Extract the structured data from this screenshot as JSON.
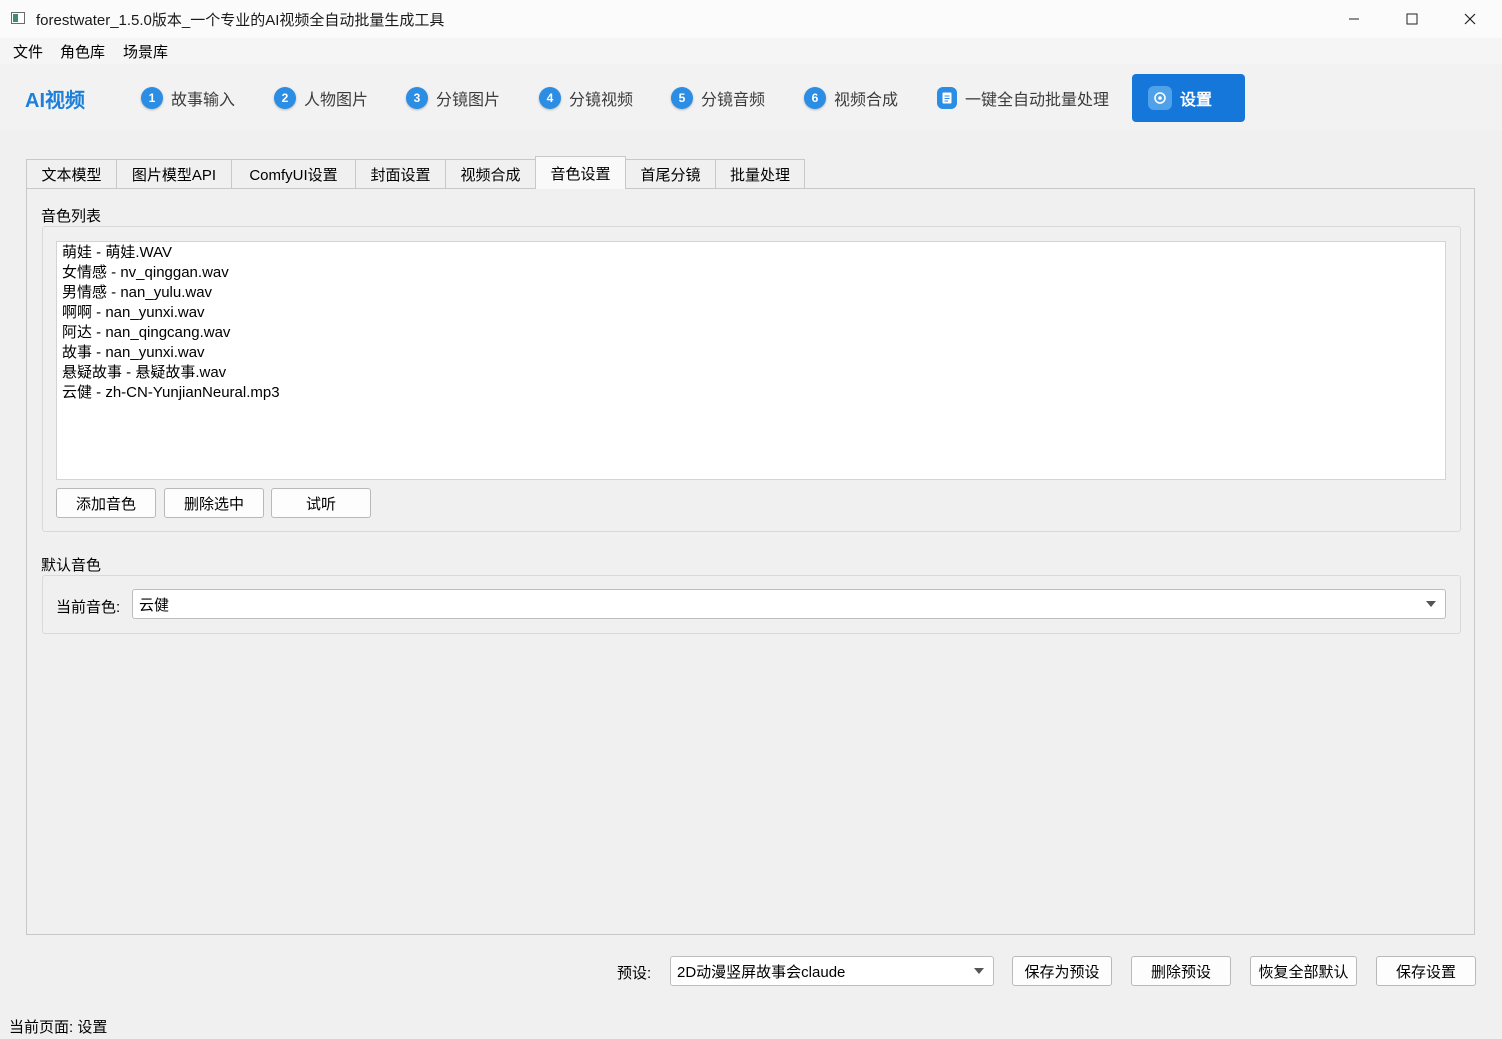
{
  "window": {
    "title": "forestwater_1.5.0版本_一个专业的AI视频全自动批量生成工具"
  },
  "menubar": {
    "items": [
      "文件",
      "角色库",
      "场景库"
    ]
  },
  "nav": {
    "brand": "AI视频",
    "steps": [
      {
        "num": "1",
        "label": "故事输入"
      },
      {
        "num": "2",
        "label": "人物图片"
      },
      {
        "num": "3",
        "label": "分镜图片"
      },
      {
        "num": "4",
        "label": "分镜视频"
      },
      {
        "num": "5",
        "label": "分镜音频"
      },
      {
        "num": "6",
        "label": "视频合成"
      }
    ],
    "batch_label": "一键全自动批量处理",
    "settings_label": "设置",
    "accent_color": "#1677db"
  },
  "tabs": [
    "文本模型",
    "图片模型API",
    "ComfyUI设置",
    "封面设置",
    "视频合成",
    "音色设置",
    "首尾分镜",
    "批量处理"
  ],
  "active_tab": "音色设置",
  "voice_list": {
    "title": "音色列表",
    "items": [
      "萌娃 - 萌娃.WAV",
      "女情感 - nv_qinggan.wav",
      "男情感 - nan_yulu.wav",
      "啊啊 - nan_yunxi.wav",
      "阿达 - nan_qingcang.wav",
      "故事 - nan_yunxi.wav",
      "悬疑故事 - 悬疑故事.wav",
      "云健 - zh-CN-YunjianNeural.mp3"
    ],
    "add_button": "添加音色",
    "delete_button": "删除选中",
    "preview_button": "试听"
  },
  "default_voice": {
    "title": "默认音色",
    "label": "当前音色:",
    "value": "云健"
  },
  "footer": {
    "preset_label": "预设:",
    "preset_value": "2D动漫竖屏故事会claude",
    "save_as_preset": "保存为预设",
    "delete_preset": "删除预设",
    "restore_defaults": "恢复全部默认",
    "save_settings": "保存设置"
  },
  "status": {
    "text": "当前页面: 设置"
  }
}
